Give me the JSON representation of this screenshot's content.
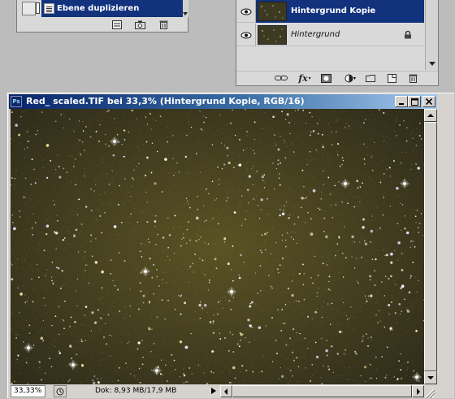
{
  "history_panel": {
    "current_state": "Ebene duplizieren",
    "toolbar_icons": [
      "new-document-from-state-icon",
      "snapshot-camera-icon",
      "trash-icon"
    ]
  },
  "layers_panel": {
    "layers": [
      {
        "name": "Hintergrund Kopie",
        "selected": true,
        "visible": true,
        "locked": false
      },
      {
        "name": "Hintergrund",
        "selected": false,
        "visible": true,
        "locked": true
      }
    ],
    "toolbar_icons": [
      "link-layers-icon",
      "fx-icon",
      "layer-mask-icon",
      "adjustment-layer-icon",
      "folder-icon",
      "new-layer-icon",
      "trash-icon"
    ],
    "fx_label": "fx"
  },
  "document": {
    "title": "Red_ scaled.TIF bei 33,3% (Hintergrund Kopie, RGB/16)",
    "app_badge": "Ps",
    "zoom": "33,33%",
    "doc_info": "Dok: 8,93 MB/17,9 MB"
  },
  "colors": {
    "selection": "#12327e",
    "title_gradient_start": "#08246b",
    "title_gradient_end": "#a6caf0",
    "sky": "#403b1f"
  }
}
